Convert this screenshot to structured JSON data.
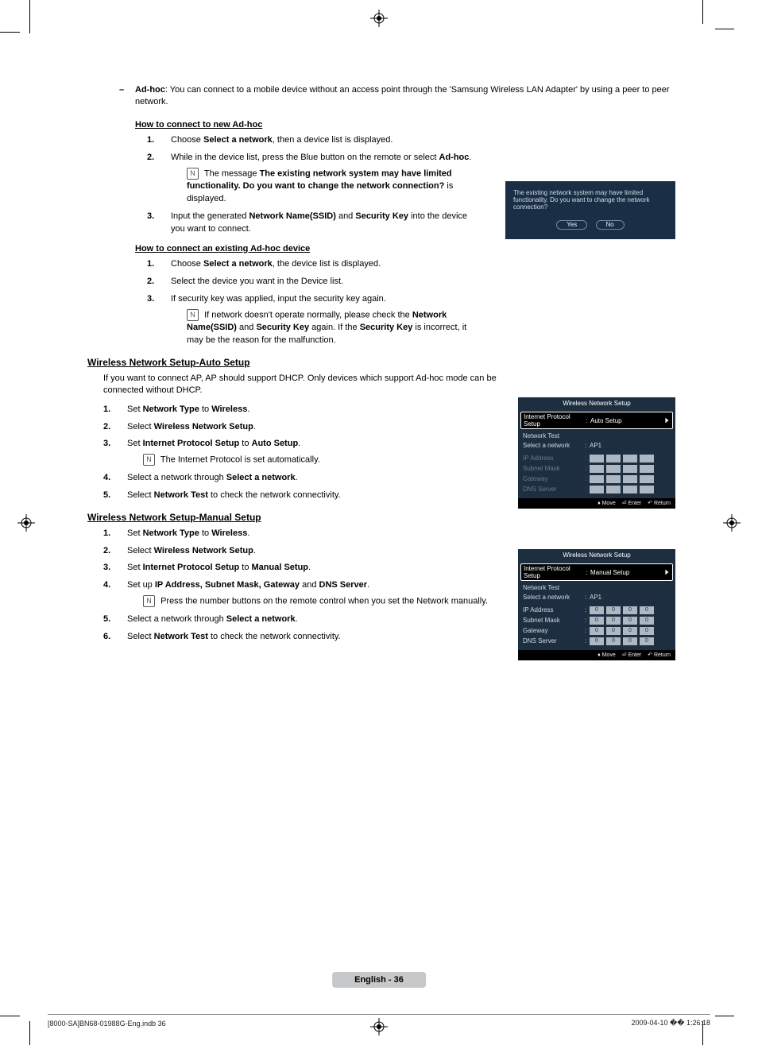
{
  "intro": {
    "term": "Ad-hoc",
    "text1": ": You can connect to a mobile device without an access point through the 'Samsung Wireless LAN Adapter' by using a peer to peer network."
  },
  "section1": {
    "title": "How to connect to new Ad-hoc",
    "steps": {
      "s1a": "Choose ",
      "s1b": "Select a network",
      "s1c": ", then a device list is displayed.",
      "s2a": "While in the device list, press the Blue button on the remote or select ",
      "s2b": "Ad-hoc",
      "s2c": ".",
      "s2note_a": "The message ",
      "s2note_b": "The existing network system may have limited functionality. Do you want to change the network connection?",
      "s2note_c": " is displayed.",
      "s3a": "Input the generated ",
      "s3b": "Network Name(SSID)",
      "s3c": " and ",
      "s3d": "Security Key",
      "s3e": " into the device you want to connect."
    }
  },
  "section2": {
    "title": "How to connect an existing Ad-hoc device",
    "steps": {
      "s1a": "Choose ",
      "s1b": "Select a network",
      "s1c": ", the device list is displayed.",
      "s2": "Select the device you want in the Device list.",
      "s3": "If security key was applied, input the security key again.",
      "s3note_a": "If network doesn't operate normally, please check the ",
      "s3note_b": "Network Name(SSID)",
      "s3note_c": " and ",
      "s3note_d": "Security Key",
      "s3note_e": " again. If the ",
      "s3note_f": "Security Key",
      "s3note_g": " is incorrect, it may be the reason for the malfunction."
    }
  },
  "section3": {
    "title": "Wireless Network Setup-Auto Setup",
    "intro": "If you want to connect AP, AP should support DHCP. Only devices which support Ad-hoc mode can be connected without DHCP.",
    "steps": {
      "s1a": "Set ",
      "s1b": "Network Type",
      "s1c": " to ",
      "s1d": "Wireless",
      "s1e": ".",
      "s2a": "Select ",
      "s2b": "Wireless Network Setup",
      "s2c": ".",
      "s3a": "Set ",
      "s3b": "Internet Protocol Setup",
      "s3c": " to ",
      "s3d": "Auto Setup",
      "s3e": ".",
      "s3note": "The Internet Protocol is set automatically.",
      "s4a": "Select a network through ",
      "s4b": "Select a network",
      "s4c": ".",
      "s5a": "Select ",
      "s5b": "Network Test",
      "s5c": " to check the network connectivity."
    }
  },
  "section4": {
    "title": "Wireless Network Setup-Manual Setup",
    "steps": {
      "s1a": "Set ",
      "s1b": "Network Type",
      "s1c": " to ",
      "s1d": "Wireless",
      "s1e": ".",
      "s2a": "Select ",
      "s2b": "Wireless Network Setup",
      "s2c": ".",
      "s3a": "Set ",
      "s3b": "Internet Protocol Setup",
      "s3c": " to ",
      "s3d": "Manual Setup",
      "s3e": ".",
      "s4a": "Set up ",
      "s4b": "IP Address, Subnet Mask, Gateway",
      "s4c": " and ",
      "s4d": "DNS Server",
      "s4e": ".",
      "s4note": "Press the number buttons on the remote control when you set the Network manually.",
      "s5a": "Select a network through ",
      "s5b": "Select a network",
      "s5c": ".",
      "s6a": "Select ",
      "s6b": "Network Test",
      "s6c": " to check the network connectivity."
    }
  },
  "dialog": {
    "text": "The existing network system may have limited functionality. Do you want to change the network connection?",
    "yes": "Yes",
    "no": "No"
  },
  "setup_auto": {
    "title": "Wireless Network Setup",
    "rows": {
      "ips_label": "Internet Protocol Setup",
      "ips_value": "Auto Setup",
      "ntest": "Network Test",
      "select_label": "Select a network",
      "select_value": "AP1",
      "ip": "IP Address",
      "mask": "Subnet Mask",
      "gw": "Gateway",
      "dns": "DNS Server"
    },
    "footer": {
      "move": "Move",
      "enter": "Enter",
      "return": "Return"
    }
  },
  "setup_manual": {
    "title": "Wireless Network Setup",
    "rows": {
      "ips_label": "Internet Protocol Setup",
      "ips_value": "Manual Setup",
      "ntest": "Network Test",
      "select_label": "Select a network",
      "select_value": "AP1",
      "ip": "IP Address",
      "mask": "Subnet Mask",
      "gw": "Gateway",
      "dns": "DNS Server"
    },
    "vals": {
      "ip": [
        "0",
        "0",
        "0",
        "0"
      ],
      "mask": [
        "0",
        "0",
        "0",
        "0"
      ],
      "gw": [
        "0",
        "0",
        "0",
        "0"
      ],
      "dns": [
        "0",
        "0",
        "0",
        "0"
      ]
    },
    "footer": {
      "move": "Move",
      "enter": "Enter",
      "return": "Return"
    }
  },
  "page_footer": {
    "pill": "English - 36",
    "left": "[8000-SA]BN68-01988G-Eng.indb   36",
    "right": "2009-04-10   �� 1:26:18"
  }
}
